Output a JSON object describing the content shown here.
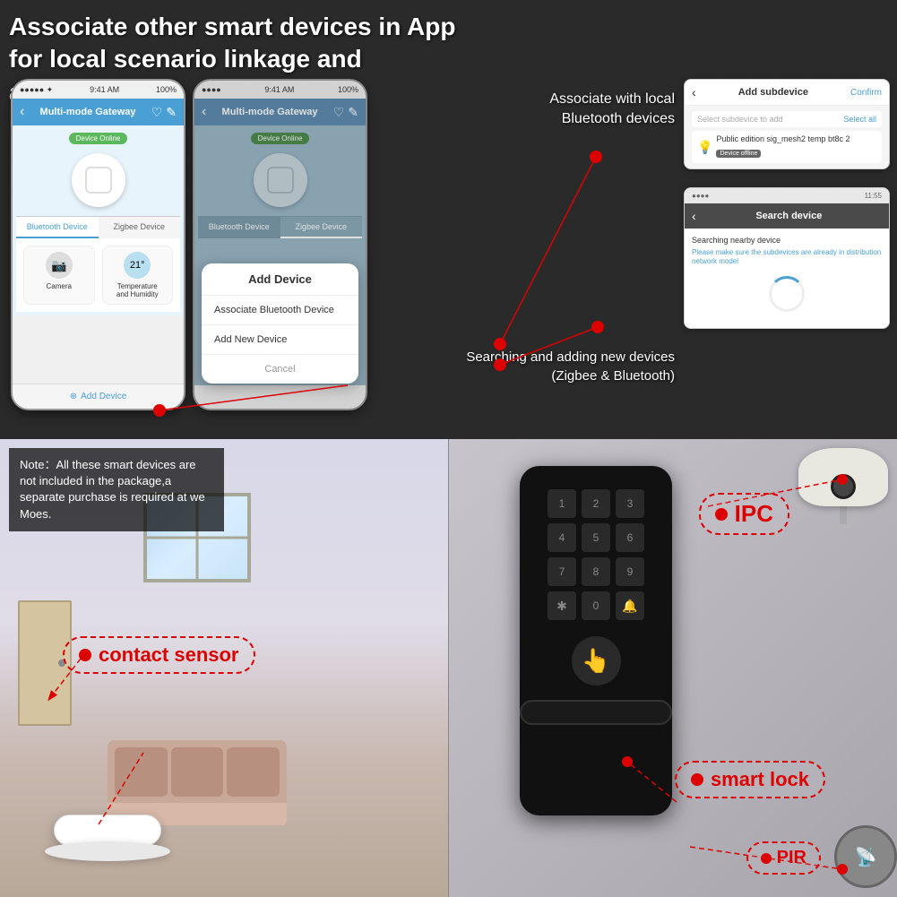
{
  "headline": "Associate other smart devices in App for local scenario linkage and automation.",
  "phone1": {
    "statusLeft": "●●●●● ✦",
    "statusTime": "9:41 AM",
    "statusRight": "100%",
    "title": "Multi-mode Gateway",
    "backIcon": "‹",
    "editIcon": "✎",
    "shieldIcon": "♡",
    "badge": "Device Online",
    "tab1": "Bluetooth Device",
    "tab2": "Zigbee Device",
    "device1Label": "Camera",
    "device2Label": "Temperature\nand Humidity",
    "addDeviceBtn": "Add Device"
  },
  "phone2": {
    "statusLeft": "●●●●",
    "statusTime": "9:41 AM",
    "statusRight": "100%",
    "title": "Multi-mode Gateway",
    "badge": "Device Online",
    "tab1": "Bluetooth Device",
    "tab2": "Zigbee Device"
  },
  "popup": {
    "title": "Add Device",
    "item1": "Associate Bluetooth Device",
    "item2": "Add New Device",
    "cancel": "Cancel"
  },
  "subdeviceScreen": {
    "title": "Add subdevice",
    "confirm": "Confirm",
    "placeholder": "Select subdevice to add",
    "selectAll": "Select all",
    "deviceName": "Public edition sig_mesh2 temp bt8c 2",
    "deviceStatus": "Device offline"
  },
  "searchScreen": {
    "statusLeft": "●●●●",
    "statusRight": "11:55",
    "title": "Search device",
    "searching": "Searching nearby device",
    "note": "Please make sure the subdevices are already in distribution network model"
  },
  "labelBluetooth": "Associate with local\nBluetooth devices",
  "labelSearching": "Searching and adding new devices\n(Zigbee & Bluetooth)",
  "bottomNote": "Note：All these smart devices are not included in the package,a separate purchase is required at we Moes.",
  "labels": {
    "contactSensor": "contact sensor",
    "ipc": "IPC",
    "smartLock": "smart lock",
    "pir": "PIR"
  },
  "colors": {
    "red": "#e00000",
    "blue": "#4a9fd4",
    "green": "#5cb85c",
    "dark": "#1a1a1a",
    "lightBg": "#e8e8f0"
  }
}
